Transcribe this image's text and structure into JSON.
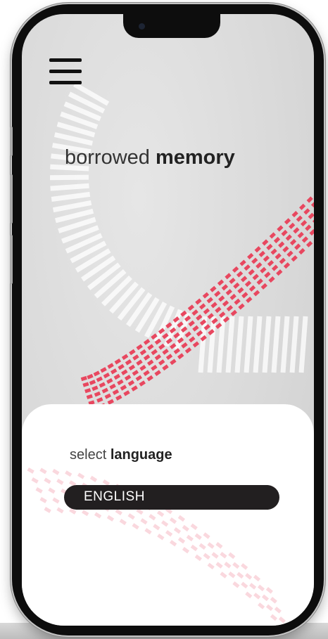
{
  "header": {
    "menu_icon": "hamburger-menu-icon",
    "title_light": "borrowed",
    "title_bold": "memory"
  },
  "language": {
    "label_light": "select",
    "label_bold": "language",
    "selected": "ENGLISH"
  },
  "colors": {
    "accent": "#e8475f",
    "background": "#dcdcdc",
    "sheet": "#ffffff",
    "select_bg": "#221f20",
    "text_dark": "#222222"
  }
}
